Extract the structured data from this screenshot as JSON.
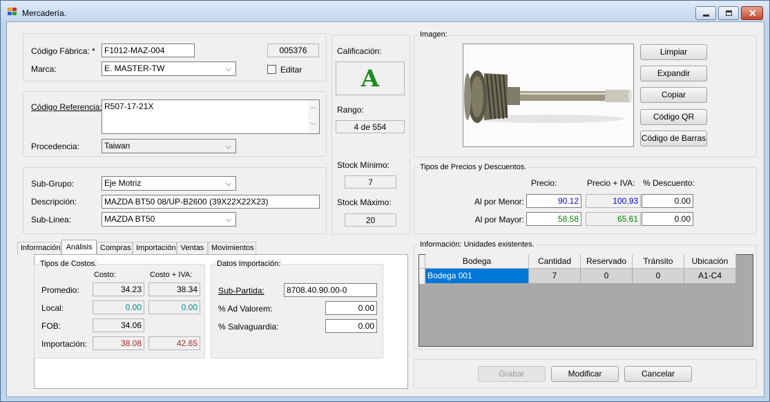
{
  "window": {
    "title": "Mercadería.",
    "controls": [
      "minimize-icon",
      "maximize-icon",
      "close-icon"
    ]
  },
  "product": {
    "codigo_fabrica_label": "Código Fábrica: *",
    "codigo_fabrica": "F1012-MAZ-004",
    "codigo_id": "005376",
    "marca_label": "Marca:",
    "marca": "E. MASTER-TW",
    "editar_label": "Editar",
    "codigo_referencia_label": "Código Referencia:",
    "codigo_referencia": "R507-17-21X",
    "procedencia_label": "Procedencia:",
    "procedencia": "Taiwan",
    "subgrupo_label": "Sub-Grupo:",
    "subgrupo": "Eje Motriz",
    "descripcion_label": "Descripción:",
    "descripcion": "MAZDA BT50 08/UP-B2600 (39X22X22X23)",
    "sublinea_label": "Sub-Linea:",
    "sublinea": "MAZDA BT50"
  },
  "rating": {
    "calificacion_label": "Calificación:",
    "calificacion": "A",
    "rango_label": "Rango:",
    "rango": "4 de 554",
    "stock_min_label": "Stock Mínimo:",
    "stock_min": "7",
    "stock_max_label": "Stock Máximo:",
    "stock_max": "20"
  },
  "image_panel": {
    "label": "Imagen:",
    "buttons": [
      "Limpiar",
      "Expandir",
      "Copiar",
      "Código QR",
      "Código de Barras"
    ]
  },
  "prices": {
    "group_label": "Tipos de Precios y Descuentos.",
    "col_precio": "Precio:",
    "col_precio_iva": "Precio + IVA:",
    "col_descuento": "% Descuento:",
    "rows": [
      {
        "label": "Al por Menor:",
        "precio": "90.12",
        "precio_iva": "100.93",
        "descuento": "0.00",
        "color": "#0000c8"
      },
      {
        "label": "Al por Mayor:",
        "precio": "58.58",
        "precio_iva": "65.61",
        "descuento": "0.00",
        "color": "#008000"
      }
    ]
  },
  "tabs": [
    "Información",
    "Análisis",
    "Compras",
    "Importación",
    "Ventas",
    "Movimientos"
  ],
  "costos": {
    "group_label": "Tipos de Costos.",
    "col_costo": "Costo:",
    "col_costo_iva": "Costo + IVA:",
    "rows": [
      {
        "label": "Promedio:",
        "costo": "34.23",
        "costo_iva": "38.34",
        "color": "#000000"
      },
      {
        "label": "Local:",
        "costo": "0.00",
        "costo_iva": "0.00",
        "color": "#008b8b"
      },
      {
        "label": "FOB:",
        "costo": "34.06",
        "costo_iva": "",
        "color": "#000000"
      },
      {
        "label": "Importación:",
        "costo": "38.08",
        "costo_iva": "42.65",
        "color": "#a52a2a"
      }
    ]
  },
  "importacion": {
    "group_label": "Datos Importación:",
    "subpartida_label": "Sub-Partida:",
    "subpartida": "8708.40.90.00-0",
    "ad_valorem_label": "% Ad Valorem:",
    "ad_valorem": "0.00",
    "salvaguardia_label": "% Salvaguardia:",
    "salvaguardia": "0.00"
  },
  "units": {
    "group_label": "Información: Unidades existentes.",
    "columns": [
      "Bodega",
      "Cantidad",
      "Reservado",
      "Tránsito",
      "Ubicación"
    ],
    "rows": [
      {
        "bodega": "Bodega 001",
        "cantidad": "7",
        "reservado": "0",
        "transito": "0",
        "ubicacion": "A1-C4"
      }
    ]
  },
  "actions": {
    "grabar": "Grabar",
    "modificar": "Modificar",
    "cancelar": "Cancelar"
  }
}
